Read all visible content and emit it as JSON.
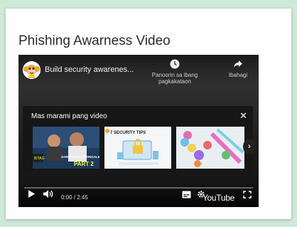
{
  "page": {
    "title": "Phishing Awarness Video"
  },
  "player": {
    "video_title": "Build security awarenes...",
    "watch_later_label": "Panoorin sa ibang pagkakataon",
    "share_label": "Ibahagi",
    "more_videos_title": "Mas marami pang video",
    "thumbnails": [
      {
        "label": "SARMIENTO SINONGALING PART 2",
        "badge": "BITAG"
      },
      {
        "label": "7 SECURITY TIPS"
      },
      {
        "label": ""
      }
    ],
    "time": "0:00 / 2:45",
    "logo": "YouTube",
    "progress_fraction": 0.0
  },
  "icons": {
    "avatar": "monkey-avatar-icon",
    "watch_later": "clock-icon",
    "share": "share-arrow-icon",
    "close": "close-icon",
    "next": "chevron-right-icon",
    "play": "play-icon",
    "volume": "volume-icon",
    "captions": "captions-icon",
    "settings": "gear-icon",
    "fullscreen": "fullscreen-icon"
  }
}
